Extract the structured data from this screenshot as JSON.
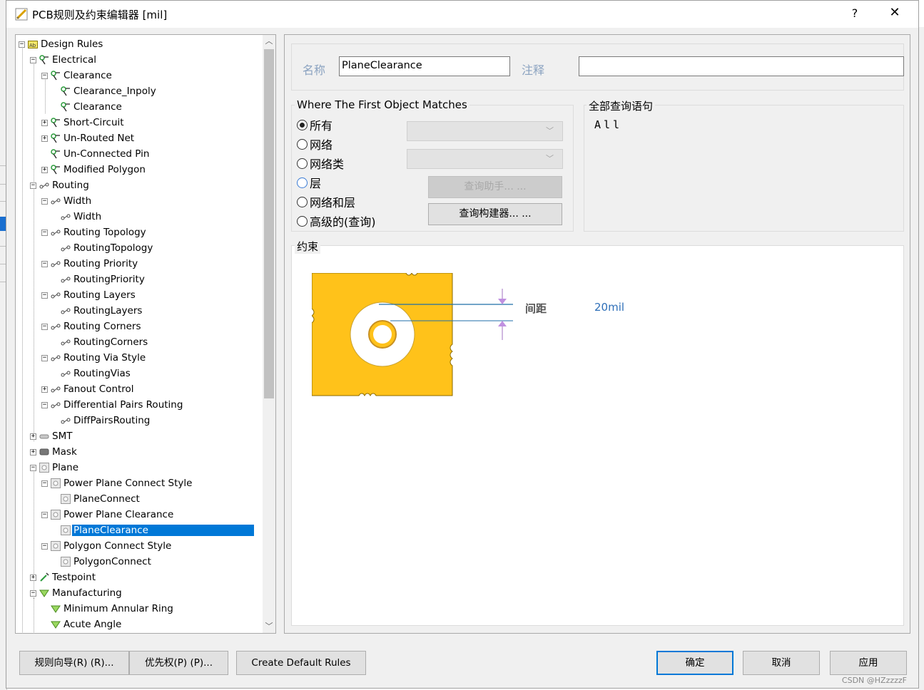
{
  "window": {
    "title": "PCB规则及约束编辑器 [mil]",
    "help_label": "?",
    "close_label": "✕"
  },
  "tree": {
    "items": [
      {
        "label": "Design Rules",
        "level": 0,
        "expander": "minus",
        "icon": "design-rules-icon"
      },
      {
        "label": "Electrical",
        "level": 1,
        "expander": "minus",
        "icon": "electrical-icon"
      },
      {
        "label": "Clearance",
        "level": 2,
        "expander": "minus",
        "icon": "electrical-icon"
      },
      {
        "label": "Clearance_Inpoly",
        "level": 3,
        "expander": "none",
        "icon": "electrical-icon"
      },
      {
        "label": "Clearance",
        "level": 3,
        "expander": "none",
        "icon": "electrical-icon"
      },
      {
        "label": "Short-Circuit",
        "level": 2,
        "expander": "plus",
        "icon": "electrical-icon"
      },
      {
        "label": "Un-Routed Net",
        "level": 2,
        "expander": "plus",
        "icon": "electrical-icon"
      },
      {
        "label": "Un-Connected Pin",
        "level": 2,
        "expander": "none",
        "icon": "electrical-icon"
      },
      {
        "label": "Modified Polygon",
        "level": 2,
        "expander": "plus",
        "icon": "electrical-icon"
      },
      {
        "label": "Routing",
        "level": 1,
        "expander": "minus",
        "icon": "routing-icon"
      },
      {
        "label": "Width",
        "level": 2,
        "expander": "minus",
        "icon": "routing-icon"
      },
      {
        "label": "Width",
        "level": 3,
        "expander": "none",
        "icon": "routing-icon"
      },
      {
        "label": "Routing Topology",
        "level": 2,
        "expander": "minus",
        "icon": "routing-icon"
      },
      {
        "label": "RoutingTopology",
        "level": 3,
        "expander": "none",
        "icon": "routing-icon"
      },
      {
        "label": "Routing Priority",
        "level": 2,
        "expander": "minus",
        "icon": "routing-icon"
      },
      {
        "label": "RoutingPriority",
        "level": 3,
        "expander": "none",
        "icon": "routing-icon"
      },
      {
        "label": "Routing Layers",
        "level": 2,
        "expander": "minus",
        "icon": "routing-icon"
      },
      {
        "label": "RoutingLayers",
        "level": 3,
        "expander": "none",
        "icon": "routing-icon"
      },
      {
        "label": "Routing Corners",
        "level": 2,
        "expander": "minus",
        "icon": "routing-icon"
      },
      {
        "label": "RoutingCorners",
        "level": 3,
        "expander": "none",
        "icon": "routing-icon"
      },
      {
        "label": "Routing Via Style",
        "level": 2,
        "expander": "minus",
        "icon": "routing-icon"
      },
      {
        "label": "RoutingVias",
        "level": 3,
        "expander": "none",
        "icon": "routing-icon"
      },
      {
        "label": "Fanout Control",
        "level": 2,
        "expander": "plus",
        "icon": "routing-icon"
      },
      {
        "label": "Differential Pairs Routing",
        "level": 2,
        "expander": "minus",
        "icon": "routing-icon"
      },
      {
        "label": "DiffPairsRouting",
        "level": 3,
        "expander": "none",
        "icon": "routing-icon"
      },
      {
        "label": "SMT",
        "level": 1,
        "expander": "plus",
        "icon": "smt-icon"
      },
      {
        "label": "Mask",
        "level": 1,
        "expander": "plus",
        "icon": "mask-icon"
      },
      {
        "label": "Plane",
        "level": 1,
        "expander": "minus",
        "icon": "plane-icon"
      },
      {
        "label": "Power Plane Connect Style",
        "level": 2,
        "expander": "minus",
        "icon": "plane-icon"
      },
      {
        "label": "PlaneConnect",
        "level": 3,
        "expander": "none",
        "icon": "plane-icon"
      },
      {
        "label": "Power Plane Clearance",
        "level": 2,
        "expander": "minus",
        "icon": "plane-icon"
      },
      {
        "label": "PlaneClearance",
        "level": 3,
        "expander": "none",
        "icon": "plane-icon",
        "selected": true
      },
      {
        "label": "Polygon Connect Style",
        "level": 2,
        "expander": "minus",
        "icon": "plane-icon"
      },
      {
        "label": "PolygonConnect",
        "level": 3,
        "expander": "none",
        "icon": "plane-icon"
      },
      {
        "label": "Testpoint",
        "level": 1,
        "expander": "plus",
        "icon": "testpoint-icon"
      },
      {
        "label": "Manufacturing",
        "level": 1,
        "expander": "minus",
        "icon": "manufacturing-icon"
      },
      {
        "label": "Minimum Annular Ring",
        "level": 2,
        "expander": "none",
        "icon": "manufacturing-icon"
      },
      {
        "label": "Acute Angle",
        "level": 2,
        "expander": "none",
        "icon": "manufacturing-icon"
      }
    ]
  },
  "rule": {
    "name_label": "名称",
    "name_value": "PlaneClearance",
    "comment_label": "注释",
    "comment_value": ""
  },
  "match": {
    "group_title": "Where The First Object Matches",
    "options": [
      "所有",
      "网络",
      "网络类",
      "层",
      "网络和层",
      "高级的(查询)"
    ],
    "selected": "所有",
    "query_helper_label": "查询助手... ...",
    "query_builder_label": "查询构建器... ..."
  },
  "query": {
    "group_title": "全部查询语句",
    "text": "All"
  },
  "constraints": {
    "group_title": "约束",
    "clearance_label": "间距",
    "clearance_value": "20mil"
  },
  "buttons": {
    "rule_wizard": "规则向导(R) (R)...",
    "priorities": "优先权(P) (P)...",
    "create_default": "Create Default Rules",
    "ok": "确定",
    "cancel": "取消",
    "apply": "应用"
  },
  "watermark": "CSDN @HZzzzzF",
  "colors": {
    "selection": "#0078d7",
    "copper": "#ffc21a",
    "clearance_value": "#2e6fb8"
  }
}
